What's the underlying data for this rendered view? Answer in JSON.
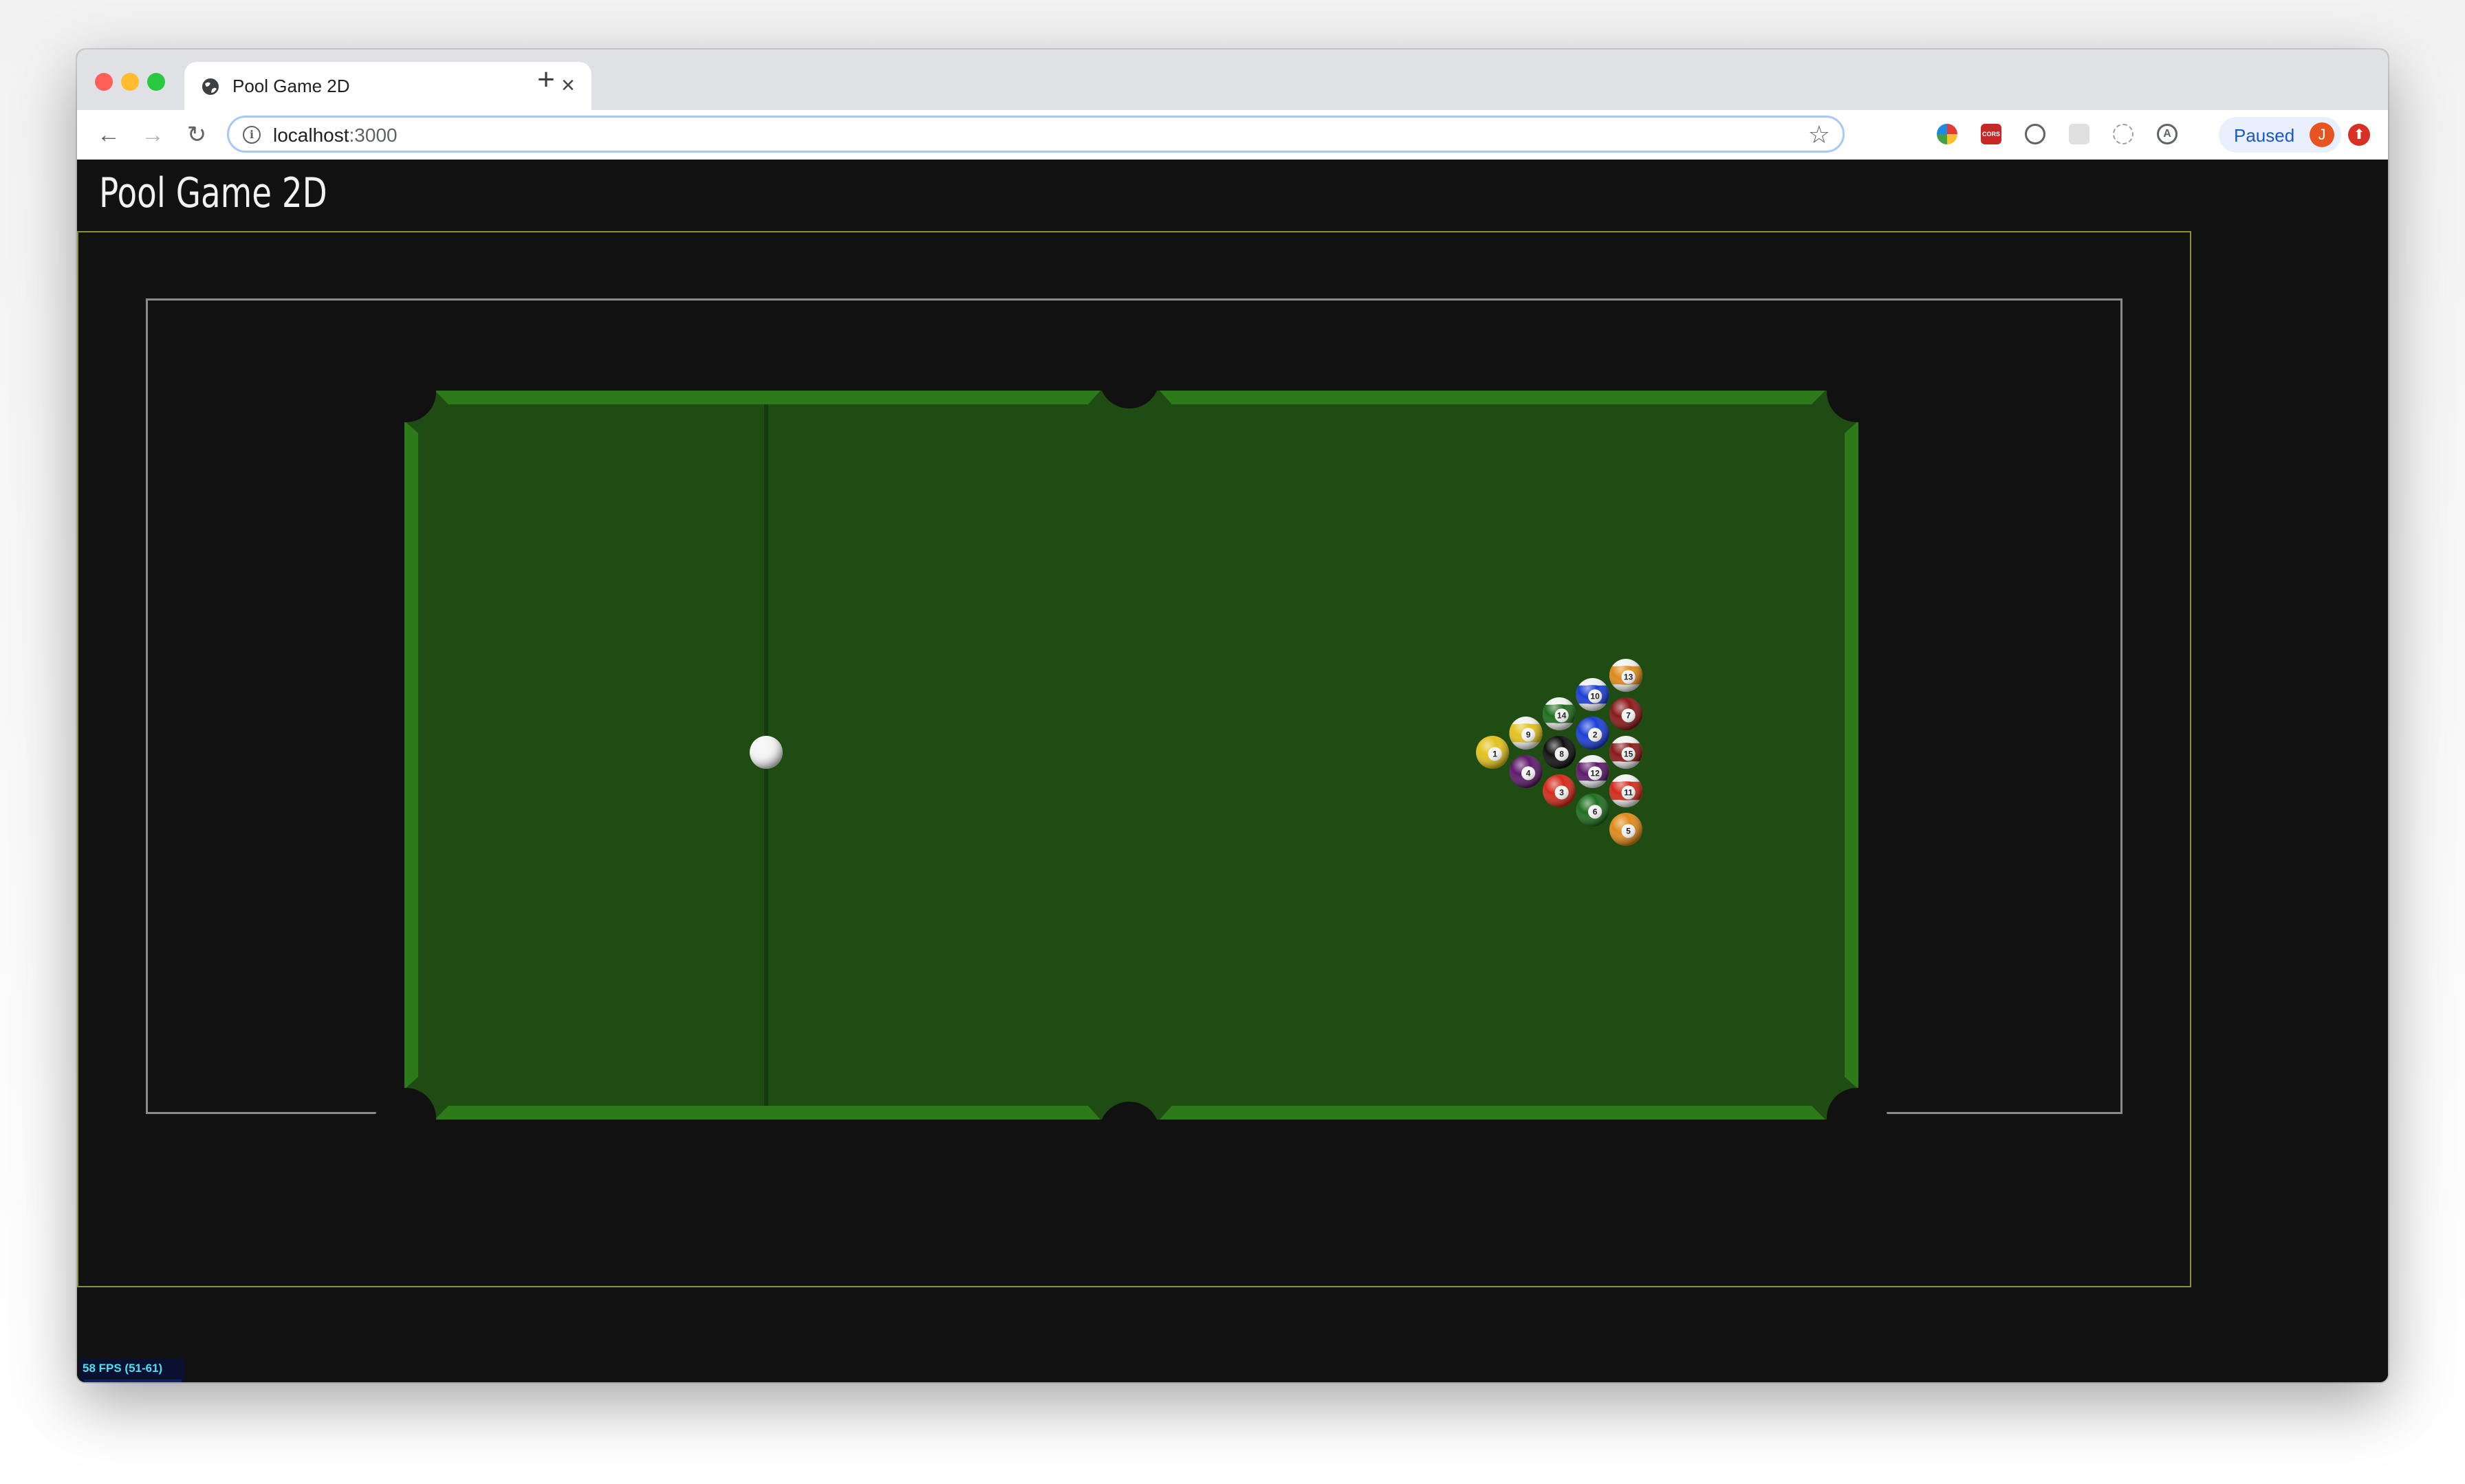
{
  "browser": {
    "tab_title": "Pool Game 2D",
    "url_host": "localhost",
    "url_port": ":3000",
    "profile_status": "Paused",
    "profile_initial": "J",
    "ext_cors_label": "CORS"
  },
  "page": {
    "title": "Pool Game 2D",
    "fps_label": "58 FPS (51-61)"
  },
  "colors": {
    "felt": "#1f4c12",
    "cushion": "#2d7a1a",
    "page_bg": "#111111",
    "frame_border": "#8a8f3c"
  },
  "game": {
    "cue_ball": {
      "color": "#f4f4f4"
    },
    "balls": [
      {
        "number": 1,
        "color": "#e3c21d",
        "stripe": false
      },
      {
        "number": 9,
        "color": "#e3c21d",
        "stripe": true
      },
      {
        "number": 4,
        "color": "#5d1a6b",
        "stripe": false
      },
      {
        "number": 14,
        "color": "#1e6e1e",
        "stripe": true
      },
      {
        "number": 8,
        "color": "#111111",
        "stripe": false
      },
      {
        "number": 3,
        "color": "#d42a1a",
        "stripe": false
      },
      {
        "number": 10,
        "color": "#1b3fd6",
        "stripe": true
      },
      {
        "number": 2,
        "color": "#1b3fd6",
        "stripe": false
      },
      {
        "number": 12,
        "color": "#5d1a6b",
        "stripe": true
      },
      {
        "number": 6,
        "color": "#1e6e1e",
        "stripe": false
      },
      {
        "number": 13,
        "color": "#e08a1a",
        "stripe": true
      },
      {
        "number": 7,
        "color": "#8a1a1a",
        "stripe": false
      },
      {
        "number": 15,
        "color": "#8a1a1a",
        "stripe": true
      },
      {
        "number": 11,
        "color": "#d42a1a",
        "stripe": true
      },
      {
        "number": 5,
        "color": "#e08a1a",
        "stripe": false
      }
    ]
  }
}
